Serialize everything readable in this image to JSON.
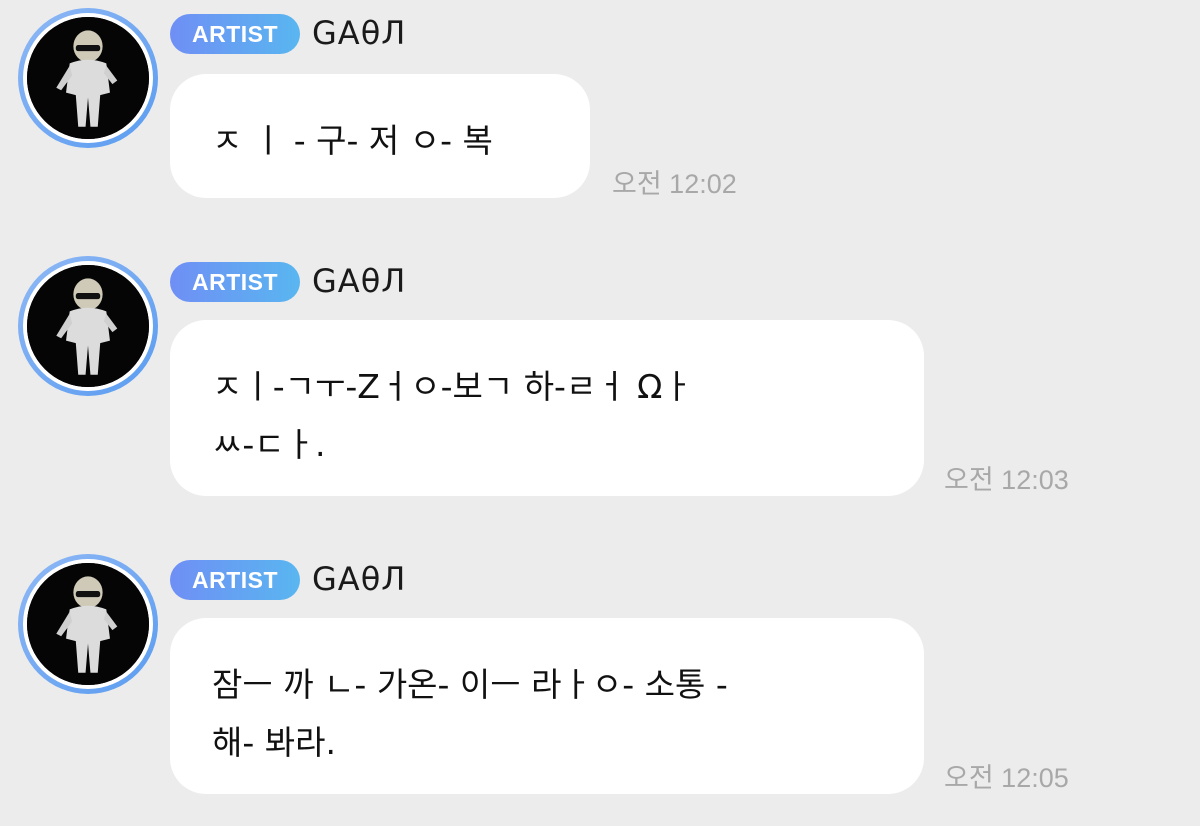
{
  "messages": [
    {
      "badge": "ARTIST",
      "sender": "GAθЛ",
      "text": "ㅈ ㅣ - 구- 저 ㅇ- 복",
      "time": "오전 12:02"
    },
    {
      "badge": "ARTIST",
      "sender": "GAθЛ",
      "text": "ㅈㅣ-ㄱㅜ-Zㅓㅇ-보ㄱ 하-ㄹㅓ Ωㅏ\nㅆ-ㄷㅏ.",
      "time": "오전 12:03"
    },
    {
      "badge": "ARTIST",
      "sender": "GAθЛ",
      "text": "잠ㅡ 까 ㄴ- 가온- 이ㅡ 라ㅏㅇ- 소통 -\n해- 봐라.",
      "time": "오전 12:05"
    }
  ]
}
